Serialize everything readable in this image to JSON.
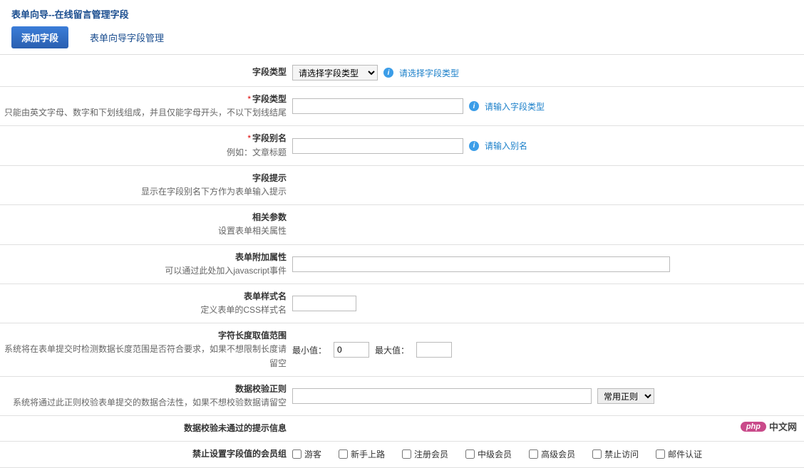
{
  "page_title": "表单向导--在线留言管理字段",
  "tabs": {
    "add_field": "添加字段",
    "manage_fields": "表单向导字段管理"
  },
  "rows": {
    "field_type_sel": {
      "label": "字段类型",
      "placeholder": "请选择字段类型",
      "hint": "请选择字段类型"
    },
    "field_type_input": {
      "label": "字段类型",
      "desc": "只能由英文字母、数字和下划线组成，并且仅能字母开头，不以下划线结尾",
      "hint": "请输入字段类型"
    },
    "field_alias": {
      "label": "字段别名",
      "desc": "例如：文章标题",
      "hint": "请输入别名"
    },
    "field_tip": {
      "label": "字段提示",
      "desc": "显示在字段别名下方作为表单输入提示"
    },
    "related_params": {
      "label": "相关参数",
      "desc": "设置表单相关属性"
    },
    "form_extra": {
      "label": "表单附加属性",
      "desc": "可以通过此处加入javascript事件"
    },
    "form_css": {
      "label": "表单样式名",
      "desc": "定义表单的CSS样式名"
    },
    "char_range": {
      "label": "字符长度取值范围",
      "desc": "系统将在表单提交时检测数据长度范围是否符合要求，如果不想限制长度请留空",
      "min_label": "最小值：",
      "max_label": "最大值：",
      "min_value": "0"
    },
    "data_regex": {
      "label": "数据校验正则",
      "desc": "系统将通过此正则校验表单提交的数据合法性，如果不想校验数据请留空",
      "select": "常用正则"
    },
    "regex_fail_msg": {
      "label": "数据校验未通过的提示信息"
    },
    "forbid_groups": {
      "label": "禁止设置字段值的会员组",
      "options": [
        "游客",
        "新手上路",
        "注册会员",
        "中级会员",
        "高级会员",
        "禁止访问",
        "邮件认证"
      ]
    }
  },
  "watermark": {
    "badge": "php",
    "text": "中文网"
  }
}
